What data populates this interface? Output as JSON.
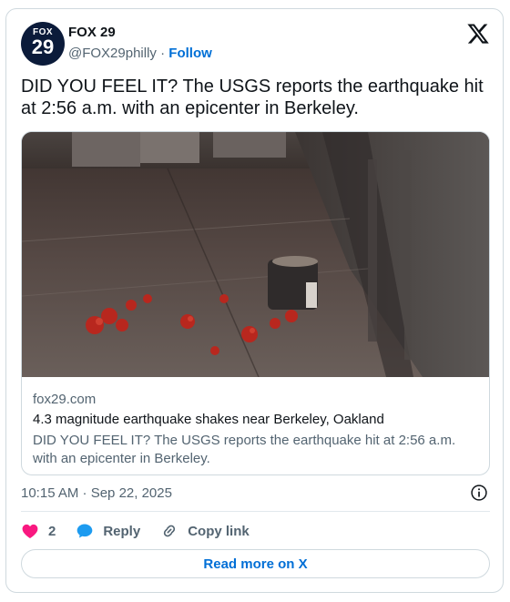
{
  "author": {
    "name": "FOX 29",
    "handle": "@FOX29philly",
    "separator": " · ",
    "follow_label": "Follow",
    "avatar_top": "FOX",
    "avatar_num": "29"
  },
  "tweet": {
    "text": "DID YOU FEEL IT? The USGS reports the earthquake hit at 2:56 a.m. with an epicenter in Berkeley."
  },
  "link_card": {
    "domain": "fox29.com",
    "title": "4.3 magnitude earthquake shakes near Berkeley, Oakland",
    "description": "DID YOU FEEL IT? The USGS reports the earthquake hit at 2:56 a.m. with an epicenter in Berkeley."
  },
  "meta": {
    "timestamp": "10:15 AM · Sep 22, 2025"
  },
  "actions": {
    "like_count": "2",
    "reply_label": "Reply",
    "copy_link_label": "Copy link"
  },
  "footer": {
    "read_more_label": "Read more on X"
  },
  "colors": {
    "brand_blue": "#006fd6",
    "like_pink": "#f91880",
    "reply_blue": "#1d9bf0",
    "secondary_text": "#536471"
  },
  "icons": {
    "x_logo": "x-logo-icon",
    "info": "info-icon",
    "like": "heart-icon",
    "reply": "speech-bubble-icon",
    "copy_link": "link-icon"
  }
}
